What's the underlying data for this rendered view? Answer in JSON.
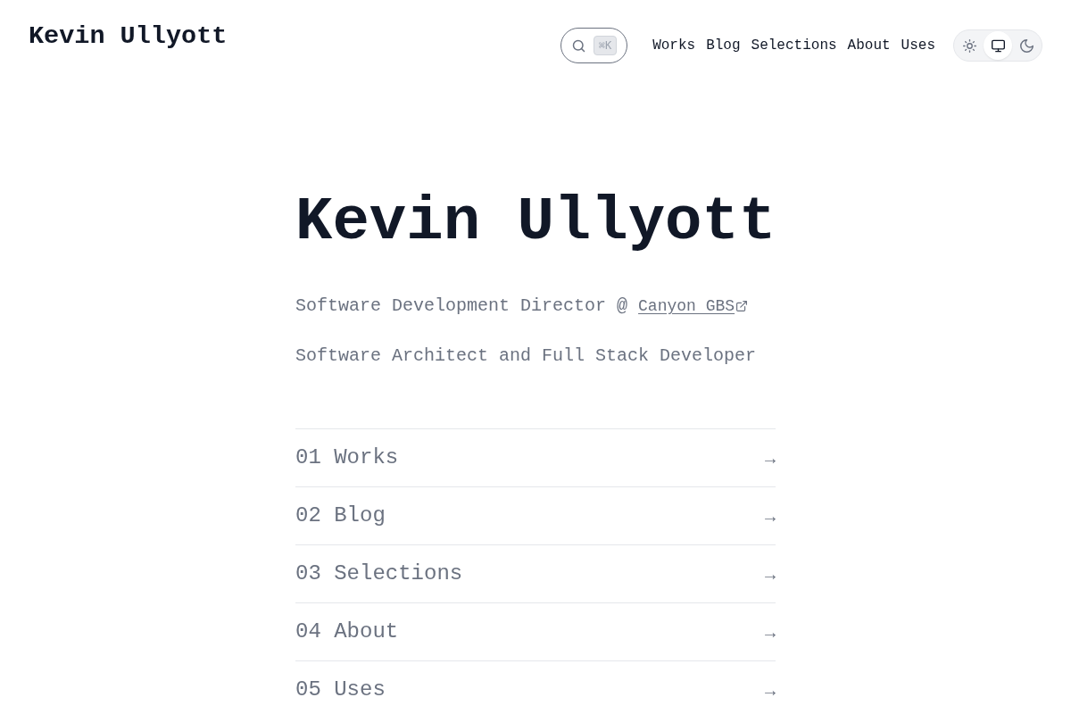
{
  "header": {
    "site_title": "Kevin Ullyott",
    "search": {
      "shortcut": "⌘K"
    },
    "nav": [
      {
        "label": "Works"
      },
      {
        "label": "Blog"
      },
      {
        "label": "Selections"
      },
      {
        "label": "About"
      },
      {
        "label": "Uses"
      }
    ],
    "theme_toggle": [
      {
        "kind": "light",
        "selected": false
      },
      {
        "kind": "system",
        "selected": true
      },
      {
        "kind": "dark",
        "selected": false
      }
    ]
  },
  "hero": {
    "title": "Kevin Ullyott",
    "lines": [
      {
        "text": "Software Development Director @",
        "link": "Canyon GBS"
      },
      {
        "text": "Software Architect and Full Stack Developer"
      }
    ]
  },
  "sections": [
    {
      "label": "01 Works",
      "arrow": "→"
    },
    {
      "label": "02 Blog",
      "arrow": "→"
    },
    {
      "label": "03 Selections",
      "arrow": "→"
    },
    {
      "label": "04 About",
      "arrow": "→"
    },
    {
      "label": "05 Uses",
      "arrow": "→"
    }
  ]
}
